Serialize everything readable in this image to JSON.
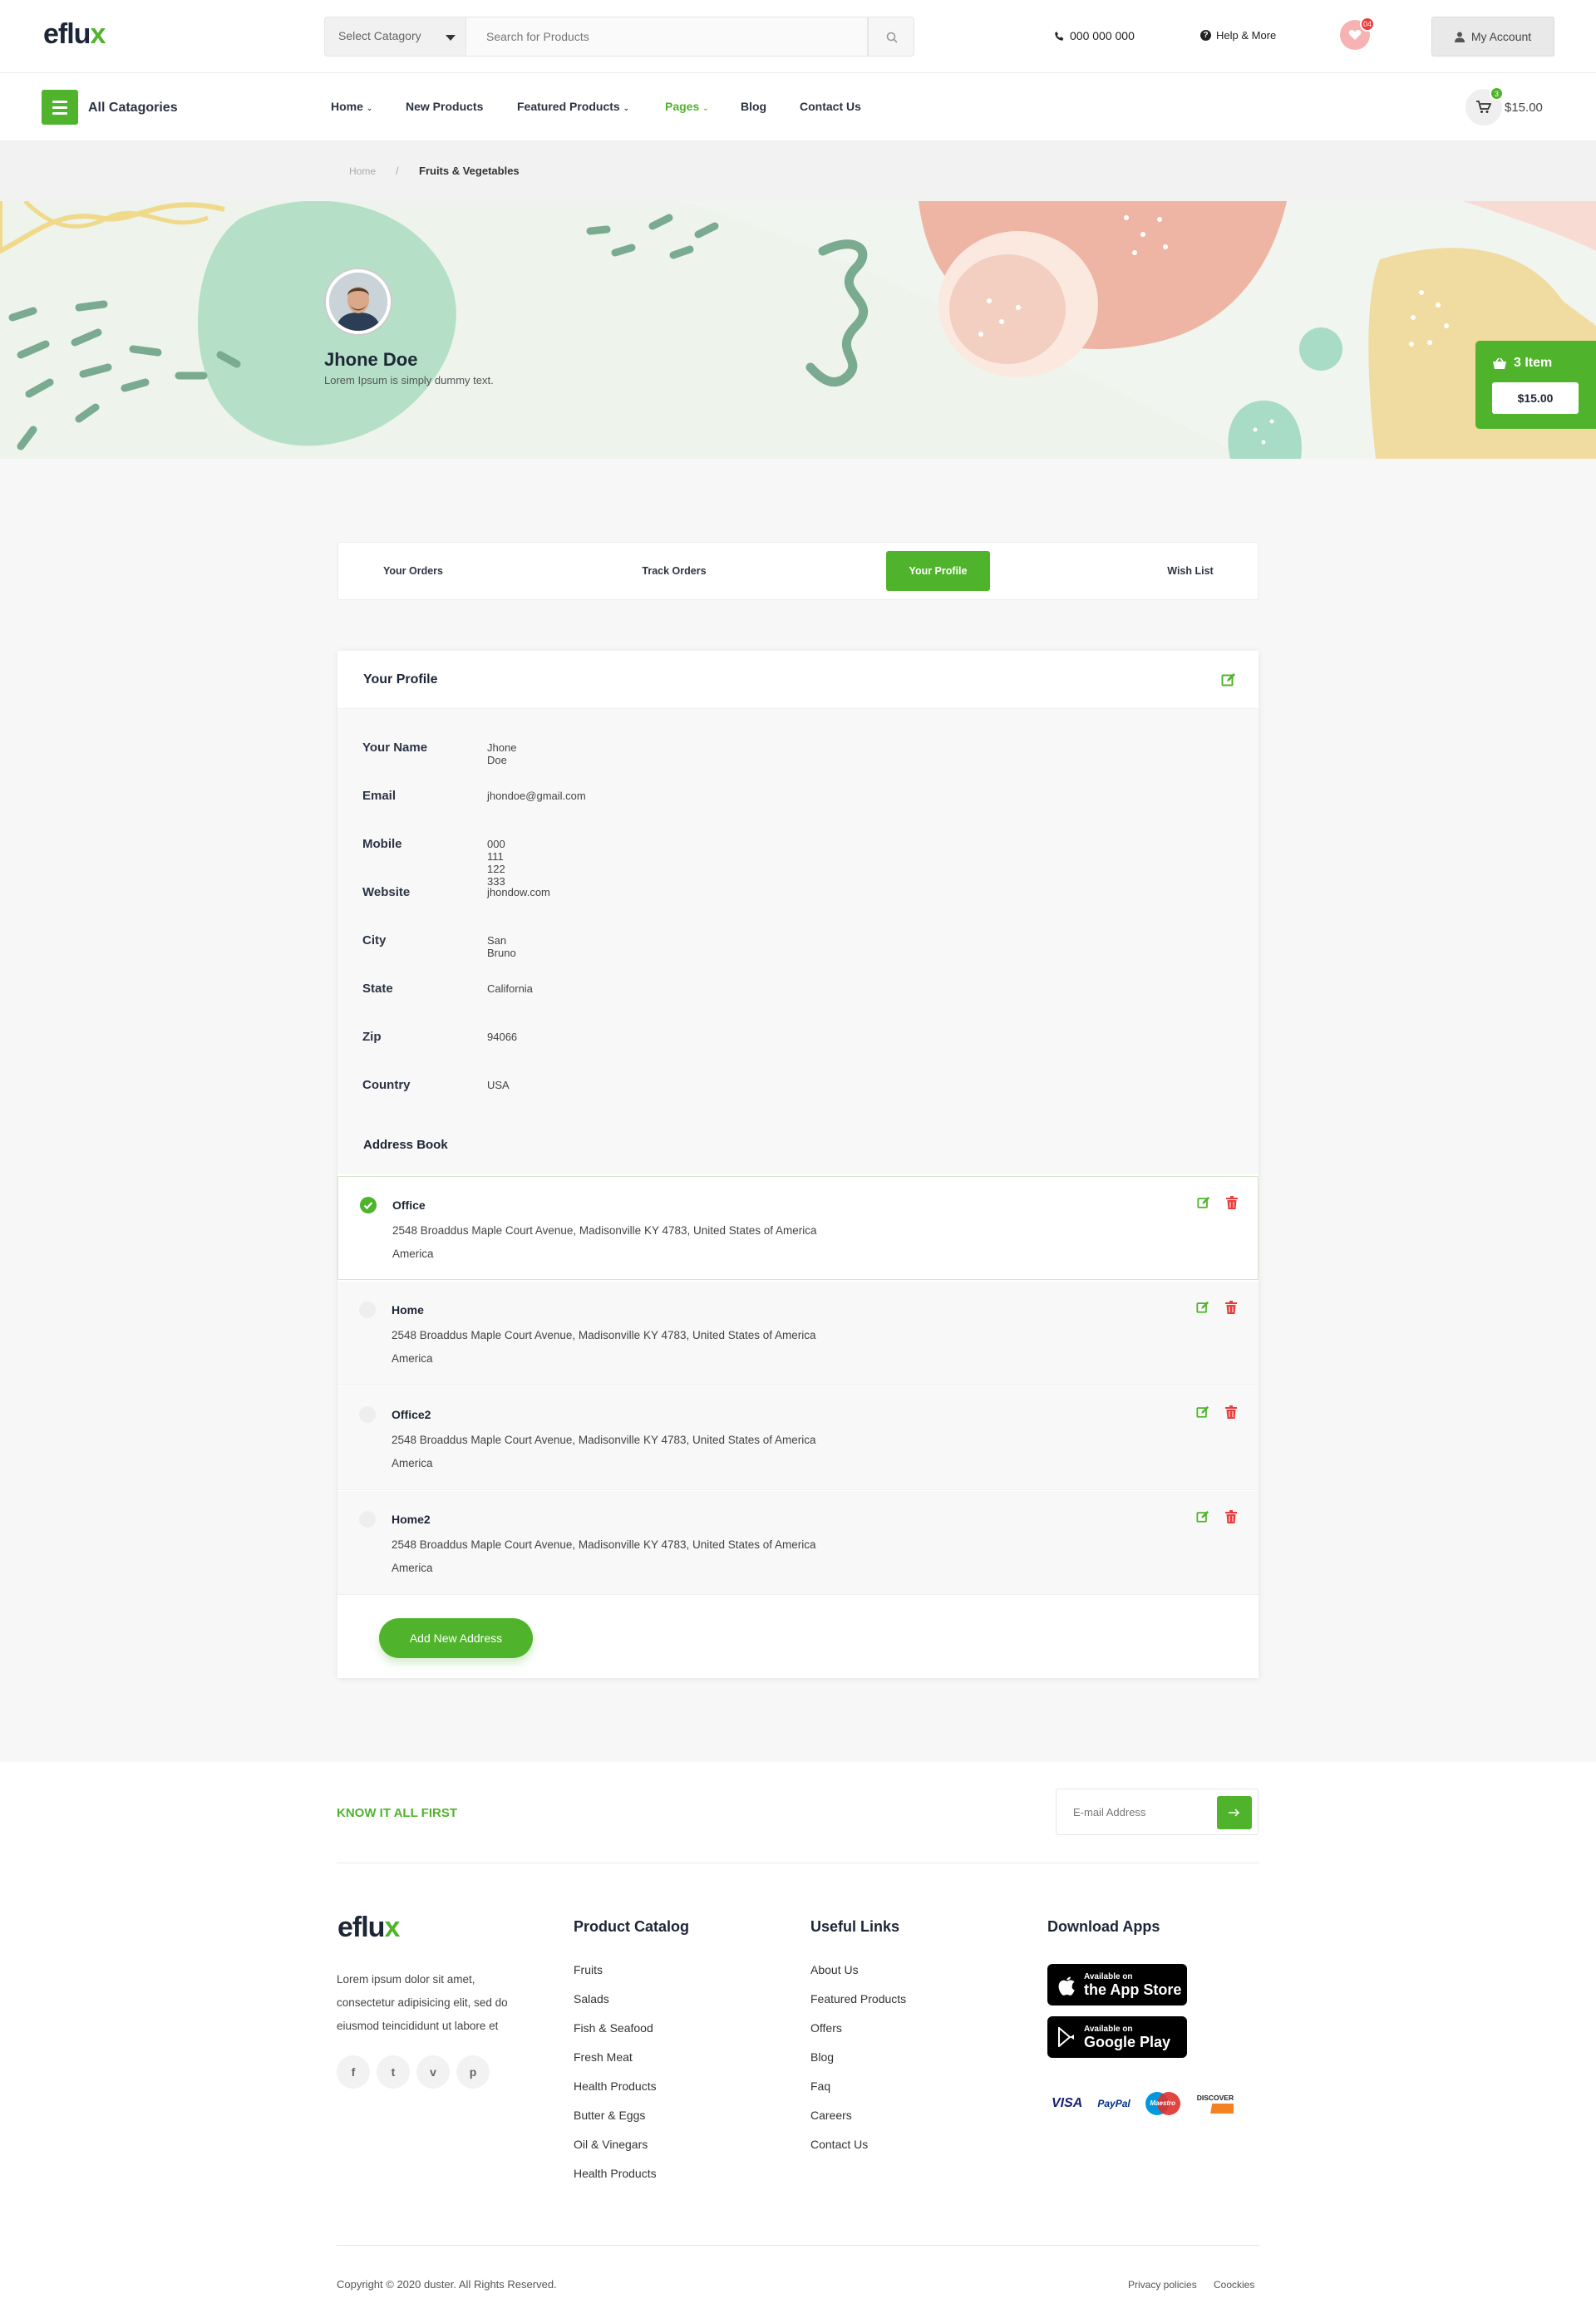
{
  "header": {
    "logo": {
      "main": "eflu",
      "mark": "x"
    },
    "category_select": "Select Catagory",
    "search_placeholder": "Search for Products",
    "phone": "000 000 000",
    "help": "Help & More",
    "wishlist_count": "04",
    "account": "My Account"
  },
  "nav": {
    "all_categories": "All Catagories",
    "items": [
      "Home",
      "New Products",
      "Featured Products",
      "Pages",
      "Blog",
      "Contact Us"
    ],
    "cart_count": "3",
    "cart_total": "$15.00"
  },
  "breadcrumb": {
    "home": "Home",
    "separator": "/",
    "current": "Fruits & Vegetables"
  },
  "banner": {
    "user_name": "Jhone Doe",
    "user_tagline": "Lorem Ipsum is simply dummy text.",
    "mini_cart_items": "3 Item",
    "mini_cart_total": "$15.00"
  },
  "tabs": [
    "Your Orders",
    "Track Orders",
    "Your Profile",
    "Wish List"
  ],
  "active_tab": "Your Profile",
  "profile": {
    "title": "Your Profile",
    "fields": [
      {
        "label": "Your Name",
        "value": "Jhone Doe"
      },
      {
        "label": "Email",
        "value": "jhondoe@gmail.com"
      },
      {
        "label": "Mobile",
        "value": "000 111 122 333"
      },
      {
        "label": "Website",
        "value": "jhondow.com"
      },
      {
        "label": "City",
        "value": "San Bruno"
      },
      {
        "label": "State",
        "value": "California"
      },
      {
        "label": "Zip",
        "value": "94066"
      },
      {
        "label": "Country",
        "value": "USA"
      }
    ]
  },
  "address_book": {
    "title": "Address Book",
    "addresses": [
      {
        "name": "Office",
        "line1": "2548 Broaddus Maple Court Avenue, Madisonville KY 4783, United States of America",
        "line2": "America",
        "selected": true
      },
      {
        "name": "Home",
        "line1": "2548 Broaddus Maple Court Avenue, Madisonville KY 4783, United States of America",
        "line2": "America",
        "selected": false
      },
      {
        "name": "Office2",
        "line1": "2548 Broaddus Maple Court Avenue, Madisonville KY 4783, United States of America",
        "line2": "America",
        "selected": false
      },
      {
        "name": "Home2",
        "line1": "2548 Broaddus Maple Court Avenue, Madisonville KY 4783, United States of America",
        "line2": "America",
        "selected": false
      }
    ],
    "add_button": "Add New Address"
  },
  "newsletter": {
    "title": "KNOW IT ALL FIRST",
    "email_placeholder": "E-mail Address"
  },
  "footer": {
    "about": [
      "Lorem ipsum dolor sit amet,",
      "consectetur adipisicing elit, sed do",
      "eiusmod teincididunt ut labore et"
    ],
    "socials": [
      "f",
      "t",
      "v",
      "p"
    ],
    "catalog_title": "Product Catalog",
    "catalog": [
      "Fruits",
      "Salads",
      "Fish & Seafood",
      "Fresh Meat",
      "Health Products",
      "Butter & Eggs",
      "Oil & Vinegars",
      "Health Products"
    ],
    "links_title": "Useful Links",
    "links": [
      "About Us",
      "Featured Products",
      "Offers",
      "Blog",
      "Faq",
      "Careers",
      "Contact Us"
    ],
    "apps_title": "Download Apps",
    "app_store": {
      "small": "Available on",
      "big": "the App Store"
    },
    "google_play": {
      "small": "Available on",
      "big": "Google Play"
    },
    "payments": [
      "VISA",
      "PayPal",
      "Maestro",
      "DISCOVER"
    ],
    "copyright": "Copyright © 2020 duster. All Rights Reserved.",
    "privacy": "Privacy policies",
    "cookies": "Coockies"
  },
  "colors": {
    "accent": "#4fb42b",
    "danger": "#ee3b3b",
    "text_dark": "#2b3445"
  }
}
